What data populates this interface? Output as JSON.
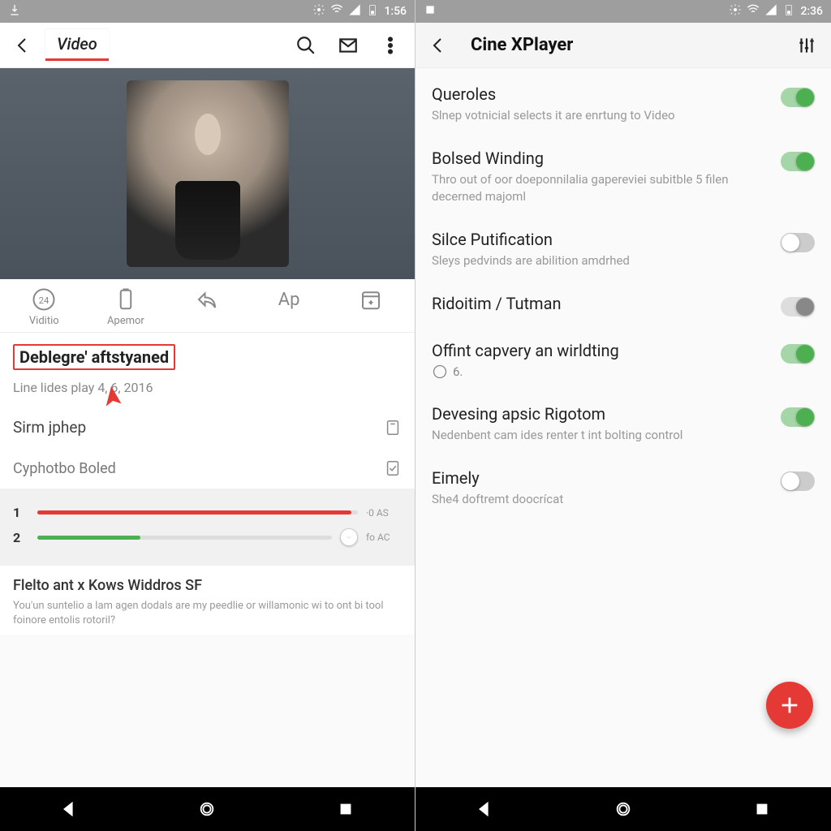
{
  "left": {
    "status": {
      "time": "1:56"
    },
    "header": {
      "tab": "Video"
    },
    "actions": {
      "items": [
        {
          "label": "Viditio"
        },
        {
          "label": "Apemor"
        },
        {
          "label": ""
        },
        {
          "label": "Ap"
        },
        {
          "label": ""
        }
      ]
    },
    "highlight": {
      "title": "Deblegre' aftstyaned",
      "subtitle": "Line lides play 4, 6, 2016"
    },
    "rows": {
      "r1": "Sirm jphep",
      "r2": "Cyphotbo Boled"
    },
    "progress": {
      "p1": {
        "num": "1",
        "tail": "·0 AS"
      },
      "p2": {
        "num": "2",
        "tail": "fo AC"
      }
    },
    "card": {
      "title": "Flelto ant x Kows Widdros SF",
      "body": "You'un suntelio a lam agen dodals are my peedlie or willamonic wi to ont bi tool foinore entolis rotoril?"
    }
  },
  "right": {
    "status": {
      "time": "2:36"
    },
    "header": {
      "title": "Cine XPlayer"
    },
    "settings": [
      {
        "title": "Queroles",
        "desc": "Slnep votnicial selects it are enrtung to Video",
        "state": "on"
      },
      {
        "title": "Bolsed Winding",
        "desc": "Thro out of oor doeponnilalia gapereviei subitble 5 filen decerned majoml",
        "state": "on"
      },
      {
        "title": "Silce Putification",
        "desc": "Sleys pedvinds are abilition amdrhed",
        "state": "off"
      },
      {
        "title": "Ridoitim / Tutman",
        "desc": "",
        "state": "neutral"
      },
      {
        "title": "Offint capvery an wirldting",
        "desc": "",
        "state": "on",
        "subval": "6."
      },
      {
        "title": "Devesing apsic Rigotom",
        "desc": "Nedenbent cam ides renter t int bolting control",
        "state": "on"
      },
      {
        "title": "Eimely",
        "desc": "She4 doftremt doocrícat",
        "state": "off"
      }
    ]
  }
}
